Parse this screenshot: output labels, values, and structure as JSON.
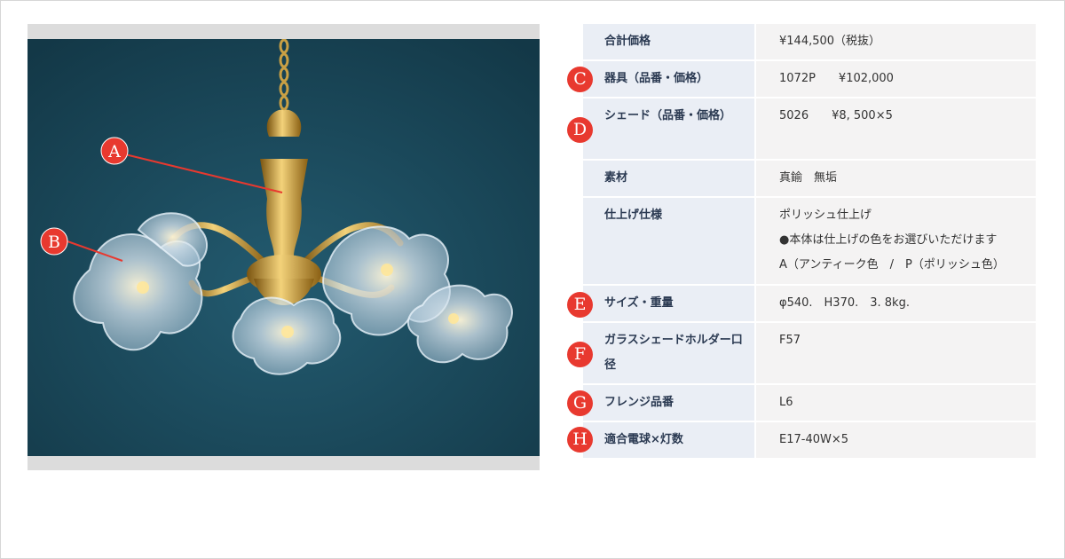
{
  "photo": {
    "callouts": [
      {
        "letter": "A"
      },
      {
        "letter": "B"
      }
    ]
  },
  "spec": {
    "rows": [
      {
        "label": "合計価格",
        "value_lines": [
          "¥144,500（税抜）"
        ],
        "badge": ""
      },
      {
        "label": "器具（品番・価格）",
        "value_lines": [
          "1072P　　¥102,000"
        ],
        "badge": "C"
      },
      {
        "label": "シェード（品番・価格）",
        "value_lines": [
          "5026　　¥8, 500×5"
        ],
        "badge": "D"
      },
      {
        "label": "素材",
        "value_lines": [
          "真鍮　無垢"
        ],
        "badge": ""
      },
      {
        "label": "仕上げ仕様",
        "value_lines": [
          "ポリッシュ仕上げ",
          "●本体は仕上げの色をお選びいただけます",
          "A（アンティーク色　/　P（ポリッシュ色）"
        ],
        "badge": ""
      },
      {
        "label": "サイズ・重量",
        "value_lines": [
          "φ540.　H370.　3. 8kg."
        ],
        "badge": "E"
      },
      {
        "label": "ガラスシェードホルダー口径",
        "value_lines": [
          "F57"
        ],
        "badge": "F"
      },
      {
        "label": "フレンジ品番",
        "value_lines": [
          "L6"
        ],
        "badge": "G"
      },
      {
        "label": "適合電球×灯数",
        "value_lines": [
          "E17-40W×5"
        ],
        "badge": "H"
      }
    ]
  },
  "colors": {
    "badge": "#e8392f",
    "label_bg": "#eaeef5",
    "value_bg": "#f4f3f3",
    "photo_bg": "#1a4a5e"
  }
}
